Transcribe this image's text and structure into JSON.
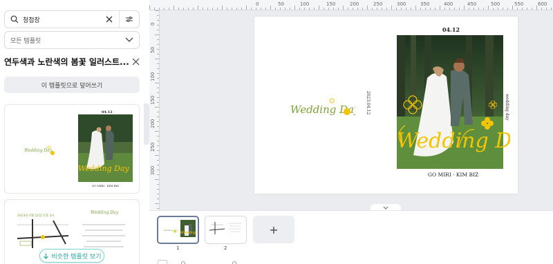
{
  "search": {
    "query": "청첩장"
  },
  "filter_dropdown": {
    "selected": "모든 템플릿"
  },
  "template": {
    "title": "연두색과 노란색의 봄꽃 일러스트...",
    "apply_label": "이 템플릿으로 덮어쓰기",
    "similar_label": "비슷한 템플릿 보기"
  },
  "card2": {
    "line1": "2023년 4월 12일 오후 2시"
  },
  "ruler": {
    "top_labels": [
      "0",
      "50",
      "100",
      "150",
      "200",
      "250",
      "300",
      "350",
      "400",
      "450",
      "500",
      "550",
      "600"
    ],
    "left_labels": [
      "0",
      "50",
      "100",
      "150",
      "200",
      "250",
      "300"
    ]
  },
  "invitation": {
    "date": "04.12",
    "names": "GO MIRI · KIM BIZ",
    "vertical_left": "2023.04.12",
    "vertical_right": "wedding day",
    "script_text": "Wedding Day"
  },
  "pages": {
    "page1_number": "1",
    "page2_number": "2",
    "add_symbol": "+"
  },
  "colors": {
    "accent_yellow": "#f5c400",
    "script_green": "#7da23a",
    "similar_teal": "#2aa79b"
  }
}
